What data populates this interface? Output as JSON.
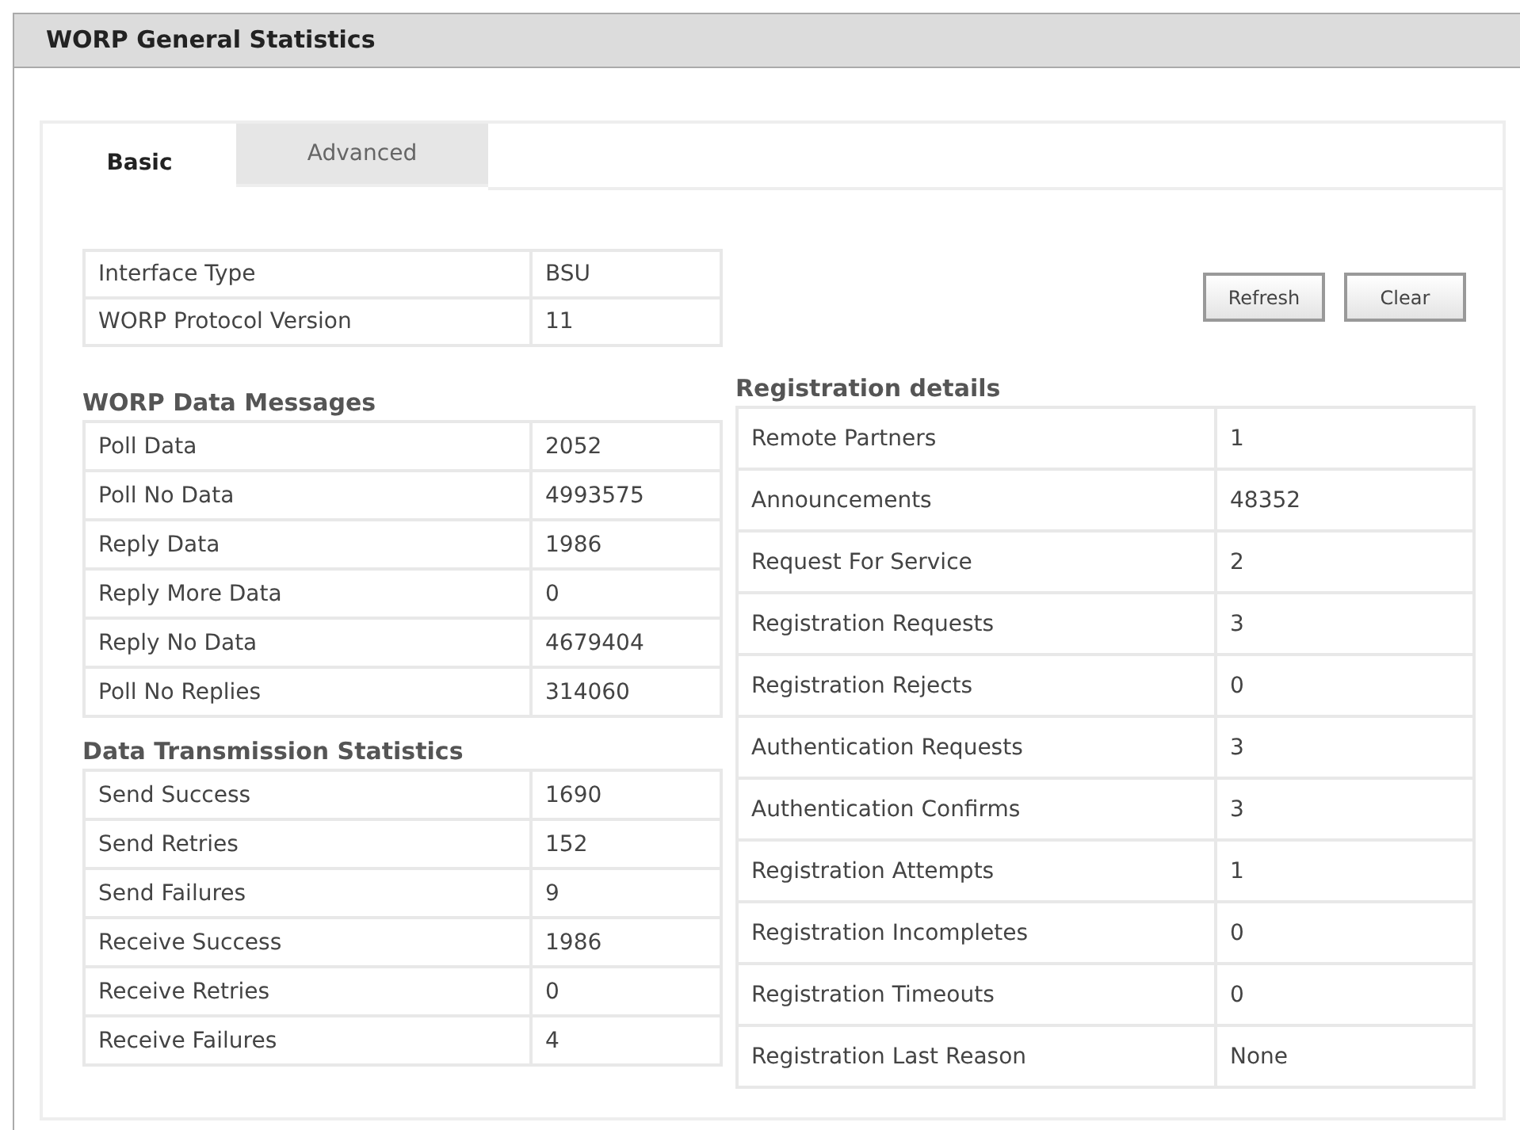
{
  "panel": {
    "title": "WORP General Statistics"
  },
  "tabs": [
    {
      "label": "Basic",
      "selected": true
    },
    {
      "label": "Advanced",
      "selected": false
    }
  ],
  "interface": [
    {
      "label": "Interface Type",
      "value": "BSU"
    },
    {
      "label": "WORP Protocol Version",
      "value": "11"
    }
  ],
  "buttons": [
    "Refresh",
    "Clear"
  ],
  "data_messages": {
    "title": "WORP Data Messages",
    "rows": [
      {
        "label": "Poll Data",
        "value": "2052"
      },
      {
        "label": "Poll No Data",
        "value": "4993575"
      },
      {
        "label": "Reply Data",
        "value": "1986"
      },
      {
        "label": "Reply More Data",
        "value": "0"
      },
      {
        "label": "Reply No Data",
        "value": "4679404"
      },
      {
        "label": "Poll No Replies",
        "value": "314060"
      }
    ]
  },
  "transmission": {
    "title": "Data Transmission Statistics",
    "rows": [
      {
        "label": "Send Success",
        "value": "1690"
      },
      {
        "label": "Send Retries",
        "value": "152"
      },
      {
        "label": "Send Failures",
        "value": "9"
      },
      {
        "label": "Receive Success",
        "value": "1986"
      },
      {
        "label": "Receive Retries",
        "value": "0"
      },
      {
        "label": "Receive Failures",
        "value": "4"
      }
    ]
  },
  "registration": {
    "title": "Registration details",
    "rows": [
      {
        "label": "Remote Partners",
        "value": "1"
      },
      {
        "label": "Announcements",
        "value": "48352"
      },
      {
        "label": "Request For Service",
        "value": "2"
      },
      {
        "label": "Registration Requests",
        "value": "3"
      },
      {
        "label": "Registration Rejects",
        "value": "0"
      },
      {
        "label": "Authentication Requests",
        "value": "3"
      },
      {
        "label": "Authentication Confirms",
        "value": "3"
      },
      {
        "label": "Registration Attempts",
        "value": "1"
      },
      {
        "label": "Registration Incompletes",
        "value": "0"
      },
      {
        "label": "Registration Timeouts",
        "value": "0"
      },
      {
        "label": "Registration Last Reason",
        "value": "None"
      }
    ]
  }
}
